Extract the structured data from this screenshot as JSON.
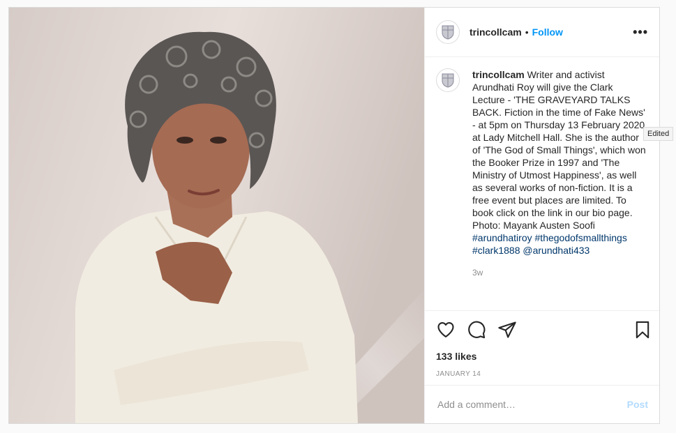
{
  "post": {
    "photo_alt": "photo",
    "header": {
      "username": "trincollcam",
      "separator": "•",
      "follow_label": "Follow",
      "more_label": "•••",
      "avatar_icon": "college-crest-icon"
    },
    "caption": {
      "username": "trincollcam",
      "text": "Writer and activist Arundhati Roy will give the Clark Lecture - 'THE GRAVEYARD TALKS BACK. Fiction in the time of Fake News' - at 5pm on Thursday 13 February 2020 at Lady Mitchell Hall. She is the author of 'The God of Small Things', which won the Booker Prize in 1997 and 'The Ministry of Utmost Happiness', as well as several works of non-fiction. It is a free event but places are limited. To book click on the link in our bio page. Photo: Mayank Austen Soofi",
      "tags": [
        "#arundhatiroy",
        "#thegodofsmallthings",
        "#clark1888",
        "@arundhati433"
      ],
      "age": "3w"
    },
    "tooltip": "Edited",
    "actions": {
      "like_icon": "heart-icon",
      "comment_icon": "comment-icon",
      "share_icon": "share-icon",
      "save_icon": "bookmark-icon"
    },
    "likes": "133 likes",
    "date": "JANUARY 14",
    "comment": {
      "placeholder": "Add a comment…",
      "value": "",
      "post_label": "Post"
    },
    "colors": {
      "link": "#0095f6",
      "hashtag": "#00376b",
      "post_disabled": "#b3dbff"
    }
  }
}
